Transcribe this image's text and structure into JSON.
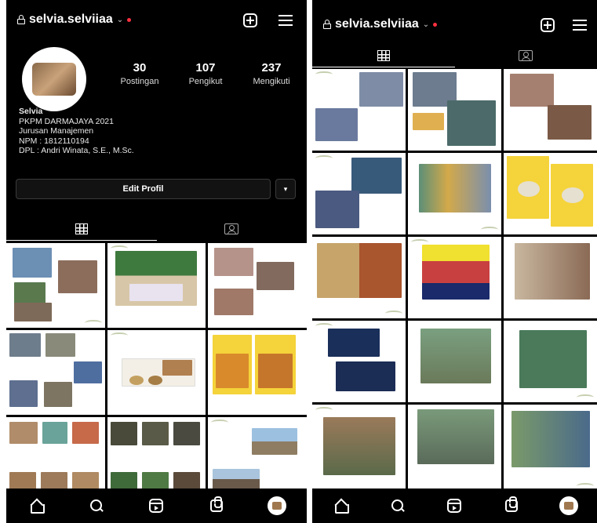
{
  "profile": {
    "username": "selvia.selviiaa",
    "stats": [
      {
        "count": "30",
        "label": "Postingan"
      },
      {
        "count": "107",
        "label": "Pengikut"
      },
      {
        "count": "237",
        "label": "Mengikuti"
      }
    ],
    "bio": {
      "name": "Selvia",
      "lines": [
        "PKPM DARMAJAYA 2021",
        "Jurusan Manajemen",
        "NPM : 1812110194",
        "DPL : Andri Winata, S.E., M.Sc."
      ]
    },
    "edit_button": "Edit Profil"
  },
  "colors": {
    "background": "#000000",
    "notification_dot": "#ff3040",
    "poster_yellow": "#f5d33a",
    "leaf_green": "#b7c39a"
  },
  "icons": {
    "lock": "lock-icon",
    "new_post": "plus-square-icon",
    "menu": "hamburger-menu-icon",
    "grid_tab": "grid-icon",
    "tagged_tab": "tagged-person-icon",
    "nav": [
      "home-icon",
      "search-icon",
      "reels-icon",
      "shop-icon",
      "profile-avatar-icon"
    ]
  }
}
